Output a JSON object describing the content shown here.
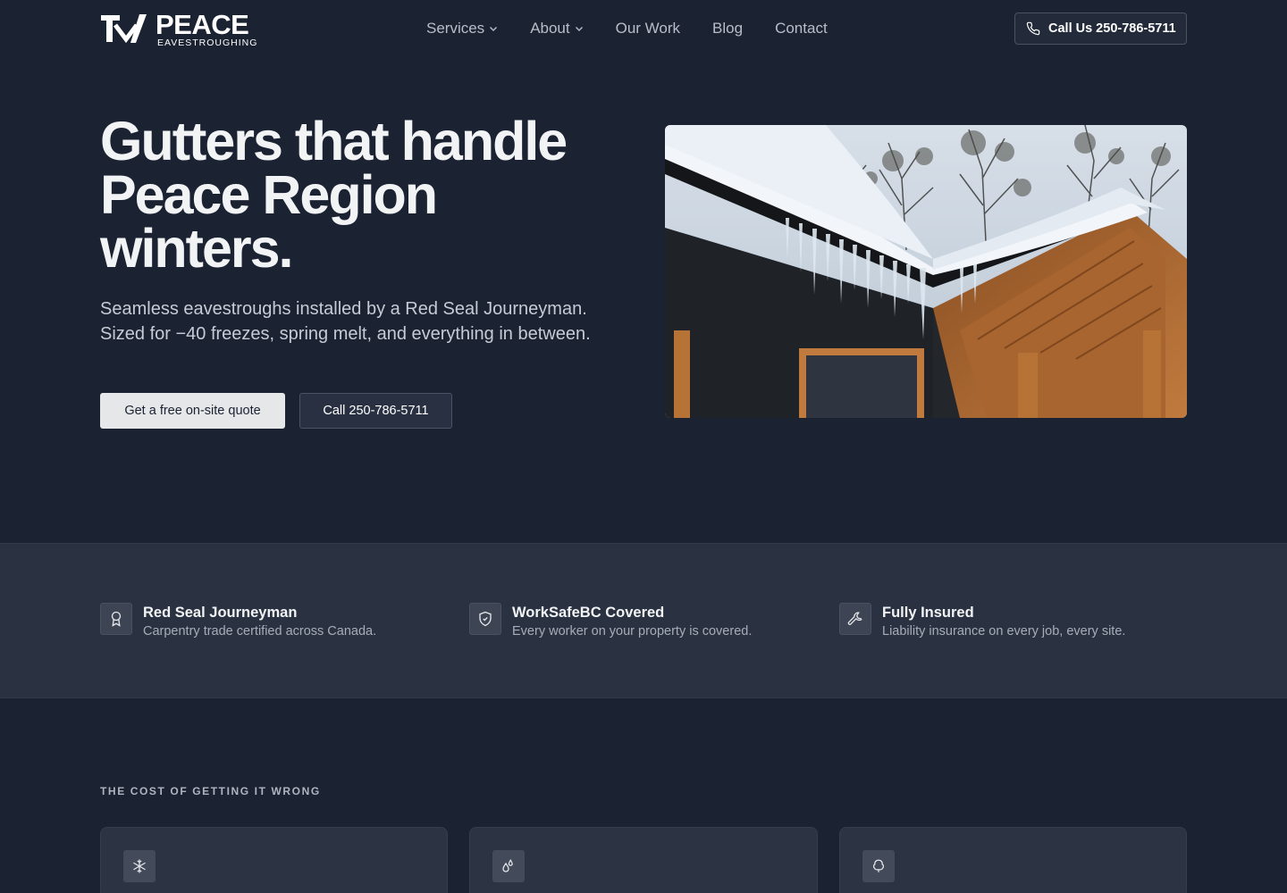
{
  "header": {
    "logo_word": "PEACE",
    "logo_sub": "EAVESTROUGHING",
    "nav": [
      {
        "label": "Services",
        "has_dropdown": true
      },
      {
        "label": "About",
        "has_dropdown": true
      },
      {
        "label": "Our Work",
        "has_dropdown": false
      },
      {
        "label": "Blog",
        "has_dropdown": false
      },
      {
        "label": "Contact",
        "has_dropdown": false
      }
    ],
    "call_label": "Call Us 250-786-5711",
    "call_icon": "phone-icon"
  },
  "hero": {
    "title": "Gutters that handle Peace Region winters.",
    "subtitle": "Seamless eavestroughs installed by a Red Seal Journeyman. Sized for −40 freezes, spring melt, and everything in between.",
    "primary_cta": "Get a free on-site quote",
    "secondary_cta": "Call 250-786-5711"
  },
  "trust": [
    {
      "icon": "award-icon",
      "title": "Red Seal Journeyman",
      "desc": "Carpentry trade certified across Canada."
    },
    {
      "icon": "shield-check-icon",
      "title": "WorkSafeBC Covered",
      "desc": "Every worker on your property is covered."
    },
    {
      "icon": "wrench-icon",
      "title": "Fully Insured",
      "desc": "Liability insurance on every job, every site."
    }
  ],
  "cost_section": {
    "eyebrow": "THE COST OF GETTING IT WRONG",
    "cards": [
      {
        "icon": "snowflake-icon"
      },
      {
        "icon": "droplets-icon"
      },
      {
        "icon": "tree-icon"
      }
    ]
  },
  "colors": {
    "background": "#1b2232",
    "band": "#2a3140",
    "card": "#2c3342",
    "primary_button": "#e6e7e9"
  }
}
